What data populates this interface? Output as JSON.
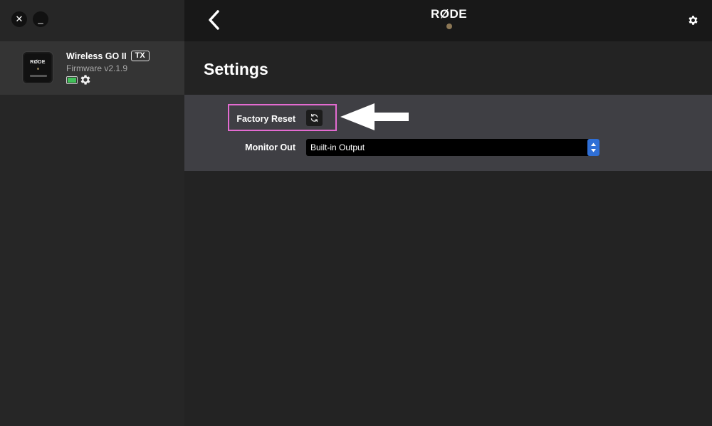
{
  "window": {
    "close_glyph": "✕",
    "minimize_glyph": "_"
  },
  "device": {
    "name": "Wireless GO II",
    "badge": "TX",
    "firmware": "Firmware v2.1.9",
    "image_logo": "RØDE",
    "battery_level": 1.0,
    "battery_color": "#42c05a"
  },
  "topbar": {
    "brand": "RØDE",
    "back_icon": "chevron-left-icon",
    "settings_icon": "gear-icon"
  },
  "page": {
    "title": "Settings"
  },
  "settings": {
    "factory_reset_label": "Factory Reset",
    "reset_icon": "refresh-icon",
    "monitor_out_label": "Monitor Out",
    "monitor_out_value": "Built-in Output"
  },
  "colors": {
    "highlight": "#e36bd1",
    "select_accent": "#2f6fd6"
  }
}
